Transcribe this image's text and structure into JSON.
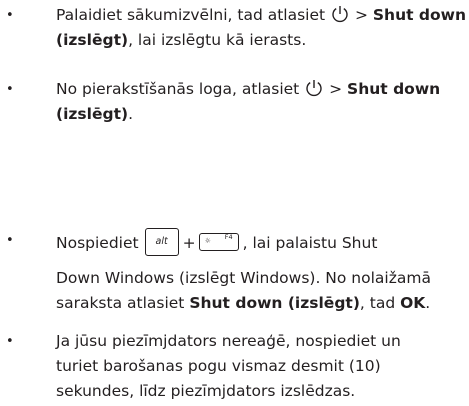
{
  "items": [
    {
      "bullet": "•",
      "pre": "Palaidiet sākumizvēlni, tad atlasiet ",
      "icon": "power-icon",
      "mid": " > ",
      "bold": "Shut down (izslēgt)",
      "post": ", lai izslēgtu kā ierasts."
    },
    {
      "bullet": "•",
      "pre": "No pierakstīšanās loga, atlasiet ",
      "icon": "power-icon",
      "mid": " > ",
      "bold": "Shut down (izslēgt)",
      "post": "."
    },
    {
      "bullet": "•",
      "pre": "Nospiediet",
      "key1": "alt",
      "plus": "+",
      "key2_label": "F4",
      "key2_symbol": "☼",
      "post": ", lai palaistu Shut",
      "para2_pre": "Down Windows (izslēgt Windows). No nolaižamā saraksta atlasiet ",
      "para2_bold1": "Shut down (izslēgt)",
      "para2_mid": ", tad ",
      "para2_bold2": "OK",
      "para2_post": "."
    },
    {
      "bullet": "•",
      "text": "Ja jūsu piezīmjdators nereaģē, nospiediet un turiet barošanas pogu vismaz desmit (10) sekundes, līdz piezīmjdators izslēdzas."
    }
  ]
}
